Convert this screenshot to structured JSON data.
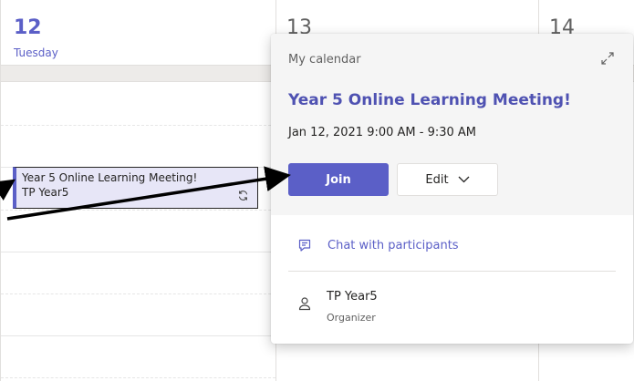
{
  "days": [
    {
      "number": "12",
      "name": "Tuesday"
    },
    {
      "number": "13"
    },
    {
      "number": "14"
    }
  ],
  "event": {
    "title": "Year 5 Online Learning Meeting!",
    "organizer": "TP Year5",
    "recurring_icon": "recurring-icon"
  },
  "popover": {
    "calendar_label": "My calendar",
    "expand_icon": "expand-icon",
    "title": "Year 5 Online Learning Meeting!",
    "time": "Jan 12, 2021 9:00 AM - 9:30 AM",
    "join_label": "Join",
    "edit_label": "Edit",
    "chat_label": "Chat with participants",
    "organizer_name": "TP Year5",
    "organizer_role": "Organizer"
  },
  "colors": {
    "accent": "#5b5fc7",
    "title": "#4f52b2",
    "event_fill": "#e7e6f7",
    "arrow": "#000000"
  }
}
